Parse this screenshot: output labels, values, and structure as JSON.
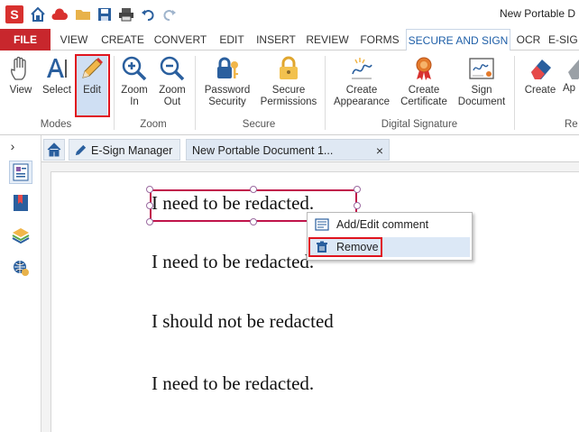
{
  "app": {
    "logo_letter": "S",
    "window_title": "New Portable D"
  },
  "menu": {
    "items": [
      "FILE",
      "VIEW",
      "CREATE",
      "CONVERT",
      "EDIT",
      "INSERT",
      "REVIEW",
      "FORMS",
      "SECURE AND SIGN",
      "OCR",
      "E-SIG"
    ],
    "active": "SECURE AND SIGN"
  },
  "ribbon": {
    "buttons": [
      {
        "id": "view",
        "label": "View",
        "icon": "hand-icon"
      },
      {
        "id": "select",
        "label": "Select",
        "icon": "text-select-icon"
      },
      {
        "id": "edit",
        "label": "Edit",
        "icon": "pencil-icon",
        "selected": true
      },
      {
        "id": "zoom-in",
        "label": "Zoom In",
        "icon": "zoom-in-icon"
      },
      {
        "id": "zoom-out",
        "label": "Zoom Out",
        "icon": "zoom-out-icon"
      },
      {
        "id": "password-security",
        "label": "Password Security",
        "icon": "lock-key-icon"
      },
      {
        "id": "secure-permissions",
        "label": "Secure Permissions",
        "icon": "padlock-icon"
      },
      {
        "id": "create-appearance",
        "label": "Create Appearance",
        "icon": "sign-icon"
      },
      {
        "id": "create-certificate",
        "label": "Create Certificate",
        "icon": "certificate-icon"
      },
      {
        "id": "sign-document",
        "label": "Sign Document",
        "icon": "sign-document-icon"
      },
      {
        "id": "create",
        "label": "Create",
        "icon": "eraser-icon"
      },
      {
        "id": "ap",
        "label": "Ap",
        "icon": "eraser-gray-icon"
      }
    ],
    "groups": [
      "Modes",
      "Zoom",
      "Secure",
      "Digital Signature",
      "Re"
    ]
  },
  "doc_tabs": {
    "esign": "E-Sign Manager",
    "document": "New Portable Document 1...",
    "close": "×"
  },
  "document": {
    "lines": [
      "I need to be redacted.",
      "I need to be redacted.",
      "I should not be redacted",
      "I need to be redacted."
    ]
  },
  "context_menu": {
    "items": [
      {
        "label": "Add/Edit comment",
        "icon": "comment-icon"
      },
      {
        "label": "Remove",
        "icon": "trash-icon"
      }
    ]
  },
  "colors": {
    "accent": "#1f5fa8",
    "file_tab": "#c8272d",
    "highlight": "#e0141e",
    "selection": "#c0144a"
  }
}
